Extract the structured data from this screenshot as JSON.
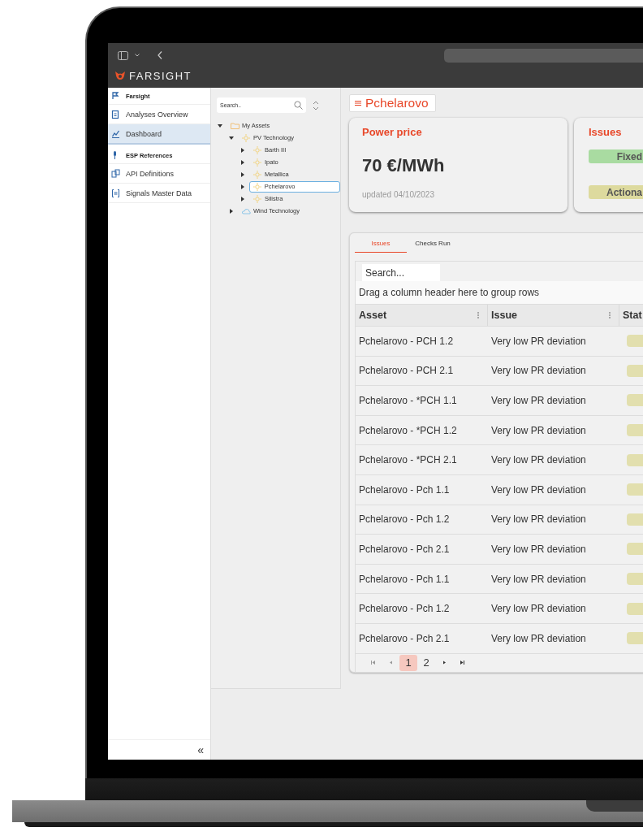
{
  "app": {
    "logo": "FARSIGHT"
  },
  "sidebar": {
    "items": [
      {
        "kind": "section",
        "label": "Farsight",
        "selected": false
      },
      {
        "kind": "link",
        "label": "Analyses Overview",
        "selected": false
      },
      {
        "kind": "link",
        "label": "Dashboard",
        "selected": true
      },
      {
        "kind": "section",
        "label": "ESP References",
        "selected": false
      },
      {
        "kind": "link",
        "label": "API Definitions",
        "selected": false
      },
      {
        "kind": "link",
        "label": "Signals Master Data",
        "selected": false
      }
    ],
    "collapse": "«"
  },
  "tree": {
    "search": {
      "placeholder": "Search.."
    },
    "nodes": [
      {
        "kind": "folder",
        "label": "My Assets",
        "expanded": true,
        "selected": false,
        "children": [
          {
            "kind": "solar",
            "label": "PV Technology",
            "expanded": true,
            "selected": false,
            "children": [
              {
                "kind": "solar",
                "label": "Barth III",
                "expanded": false,
                "selected": false
              },
              {
                "kind": "solar",
                "label": "Ipato",
                "expanded": false,
                "selected": false
              },
              {
                "kind": "solar",
                "label": "Metallica",
                "expanded": false,
                "selected": false
              },
              {
                "kind": "solar",
                "label": "Pchelarovo",
                "expanded": false,
                "selected": true
              },
              {
                "kind": "solar",
                "label": "Silistra",
                "expanded": false,
                "selected": false
              }
            ]
          },
          {
            "kind": "wind",
            "label": "Wind Technology",
            "expanded": false,
            "selected": false
          }
        ]
      }
    ]
  },
  "header": {
    "title": "Pchelarovo"
  },
  "cards": [
    {
      "kind": "metric",
      "title": "Power price",
      "value": "70 €/MWh",
      "note": "updated 04/10/2023"
    },
    {
      "kind": "badges",
      "title": "Issues",
      "badges": [
        {
          "label": "Fixed",
          "color": "#a9dba1"
        },
        {
          "label": "Actiona",
          "color": "#ddda9e"
        }
      ]
    }
  ],
  "tabs": [
    {
      "label": "Issues",
      "selected": true
    },
    {
      "label": "Checks Run",
      "selected": false
    }
  ],
  "grid": {
    "search": {
      "placeholder": "Search..."
    },
    "group_hint": "Drag a column header here to group rows",
    "columns": [
      "Asset",
      "Issue",
      "Stat"
    ],
    "rows": [
      {
        "asset": "Pchelarovo - PCH 1.2",
        "issue": "Very low PR deviation"
      },
      {
        "asset": "Pchelarovo - PCH 2.1",
        "issue": "Very low PR deviation"
      },
      {
        "asset": "Pchelarovo - *PCH 1.1",
        "issue": "Very low PR deviation"
      },
      {
        "asset": "Pchelarovo - *PCH 1.2",
        "issue": "Very low PR deviation"
      },
      {
        "asset": "Pchelarovo - *PCH 2.1",
        "issue": "Very low PR deviation"
      },
      {
        "asset": "Pchelarovo - Pch 1.1",
        "issue": "Very low PR deviation"
      },
      {
        "asset": "Pchelarovo - Pch 1.2",
        "issue": "Very low PR deviation"
      },
      {
        "asset": "Pchelarovo - Pch 2.1",
        "issue": "Very low PR deviation"
      },
      {
        "asset": "Pchelarovo - Pch 1.1",
        "issue": "Very low PR deviation"
      },
      {
        "asset": "Pchelarovo - Pch 1.2",
        "issue": "Very low PR deviation"
      },
      {
        "asset": "Pchelarovo - Pch 2.1",
        "issue": "Very low PR deviation"
      }
    ],
    "pager": {
      "pages": [
        {
          "label": "1",
          "selected": true
        },
        {
          "label": "2",
          "selected": false
        }
      ]
    }
  }
}
